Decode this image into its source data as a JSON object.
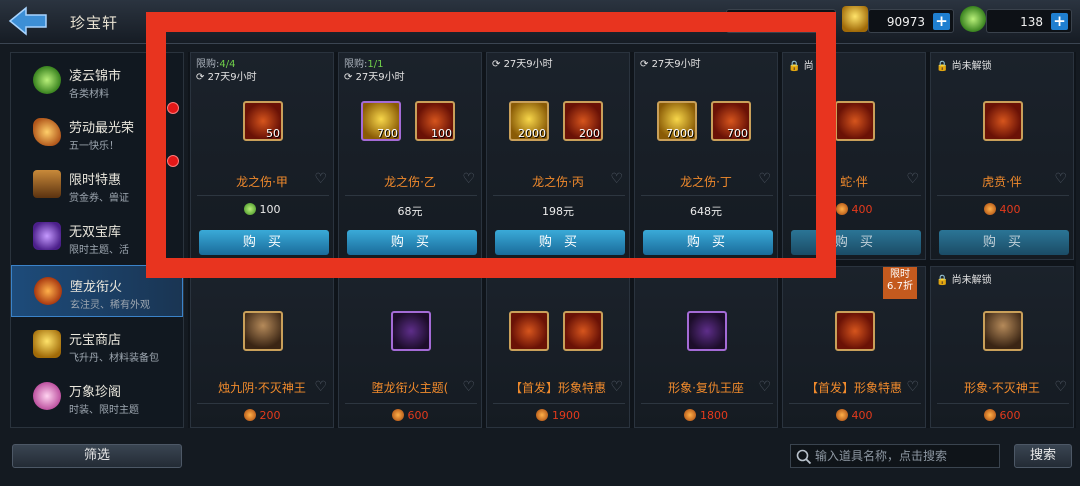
{
  "header": {
    "title": "珍宝轩",
    "currency_gold": "90973",
    "currency_jade": "138",
    "plus_label": "+"
  },
  "sidebar": {
    "items": [
      {
        "title": "凌云锦市",
        "subtitle": "各类材料",
        "icon": "jade-coin-icon"
      },
      {
        "title": "劳动最光荣",
        "subtitle": "五一快乐！",
        "icon": "wing-icon"
      },
      {
        "title": "限时特惠",
        "subtitle": "赏金券、兽证",
        "icon": "hourglass-icon"
      },
      {
        "title": "无双宝库",
        "subtitle": "限时主题、活",
        "icon": "crystal-icon"
      },
      {
        "title": "堕龙衔火",
        "subtitle": "玄注灵、稀有外观",
        "icon": "dragon-fire-icon",
        "active": true
      },
      {
        "title": "元宝商店",
        "subtitle": "飞升丹、材料装备包",
        "icon": "ingot-icon"
      },
      {
        "title": "万象珍阁",
        "subtitle": "时装、限时主题",
        "icon": "lotus-icon"
      }
    ]
  },
  "cards_row1": [
    {
      "limit_prefix": "限购:",
      "limit_value": "4/4",
      "timer": "27天9小时",
      "name": "龙之伤·甲",
      "price": "100",
      "items": [
        {
          "qty": "50",
          "kind": "fire"
        }
      ]
    },
    {
      "limit_prefix": "限购:",
      "limit_value": "1/1",
      "timer": "27天9小时",
      "name": "龙之伤·乙",
      "price": "68元",
      "items": [
        {
          "qty": "700",
          "kind": "gold-purple"
        },
        {
          "qty": "100",
          "kind": "fire"
        }
      ]
    },
    {
      "timer": "27天9小时",
      "name": "龙之伤·丙",
      "price": "198元",
      "items": [
        {
          "qty": "2000",
          "kind": "gold"
        },
        {
          "qty": "200",
          "kind": "fire"
        }
      ]
    },
    {
      "timer": "27天9小时",
      "name": "龙之伤·丁",
      "price": "648元",
      "items": [
        {
          "qty": "7000",
          "kind": "gold"
        },
        {
          "qty": "700",
          "kind": "fire"
        }
      ]
    },
    {
      "lock": "尚",
      "name": "蛇·伴",
      "price": "400",
      "items": [
        {
          "qty": "",
          "kind": "fire"
        }
      ]
    },
    {
      "lock": "尚未解锁",
      "name": "虎贲·伴",
      "price": "400",
      "items": [
        {
          "qty": "",
          "kind": "fire"
        }
      ]
    }
  ],
  "cards_row2": [
    {
      "name": "烛九阴·不灭神王",
      "price": "200",
      "items": [
        {
          "qty": "",
          "kind": "portrait"
        }
      ]
    },
    {
      "name": "堕龙衔火主题(",
      "price": "600",
      "items": [
        {
          "qty": "",
          "kind": "purple"
        }
      ]
    },
    {
      "name": "【首发】形象特惠",
      "price": "1900",
      "items": [
        {
          "qty": "",
          "kind": "fire"
        },
        {
          "qty": "",
          "kind": "fire"
        }
      ]
    },
    {
      "name": "形象·复仇王座",
      "price": "1800",
      "items": [
        {
          "qty": "",
          "kind": "purple"
        }
      ]
    },
    {
      "ribbon_line1": "限时",
      "ribbon_line2": "6.7折",
      "name": "【首发】形象特惠",
      "price": "400",
      "items": [
        {
          "qty": "",
          "kind": "fire"
        }
      ]
    },
    {
      "lock": "尚未解锁",
      "name": "形象·不灭神王",
      "price": "600",
      "items": [
        {
          "qty": "",
          "kind": "portrait"
        }
      ]
    }
  ],
  "buy_label": "购 买",
  "footer": {
    "filter_label": "筛选",
    "search_placeholder": "输入道具名称，点击搜索",
    "search_label": "搜索"
  },
  "colors": {
    "overlay": "#e8341f",
    "name_orange": "#f08a2c",
    "price_red": "#e43a1c",
    "accent_blue": "#3aaad8"
  }
}
